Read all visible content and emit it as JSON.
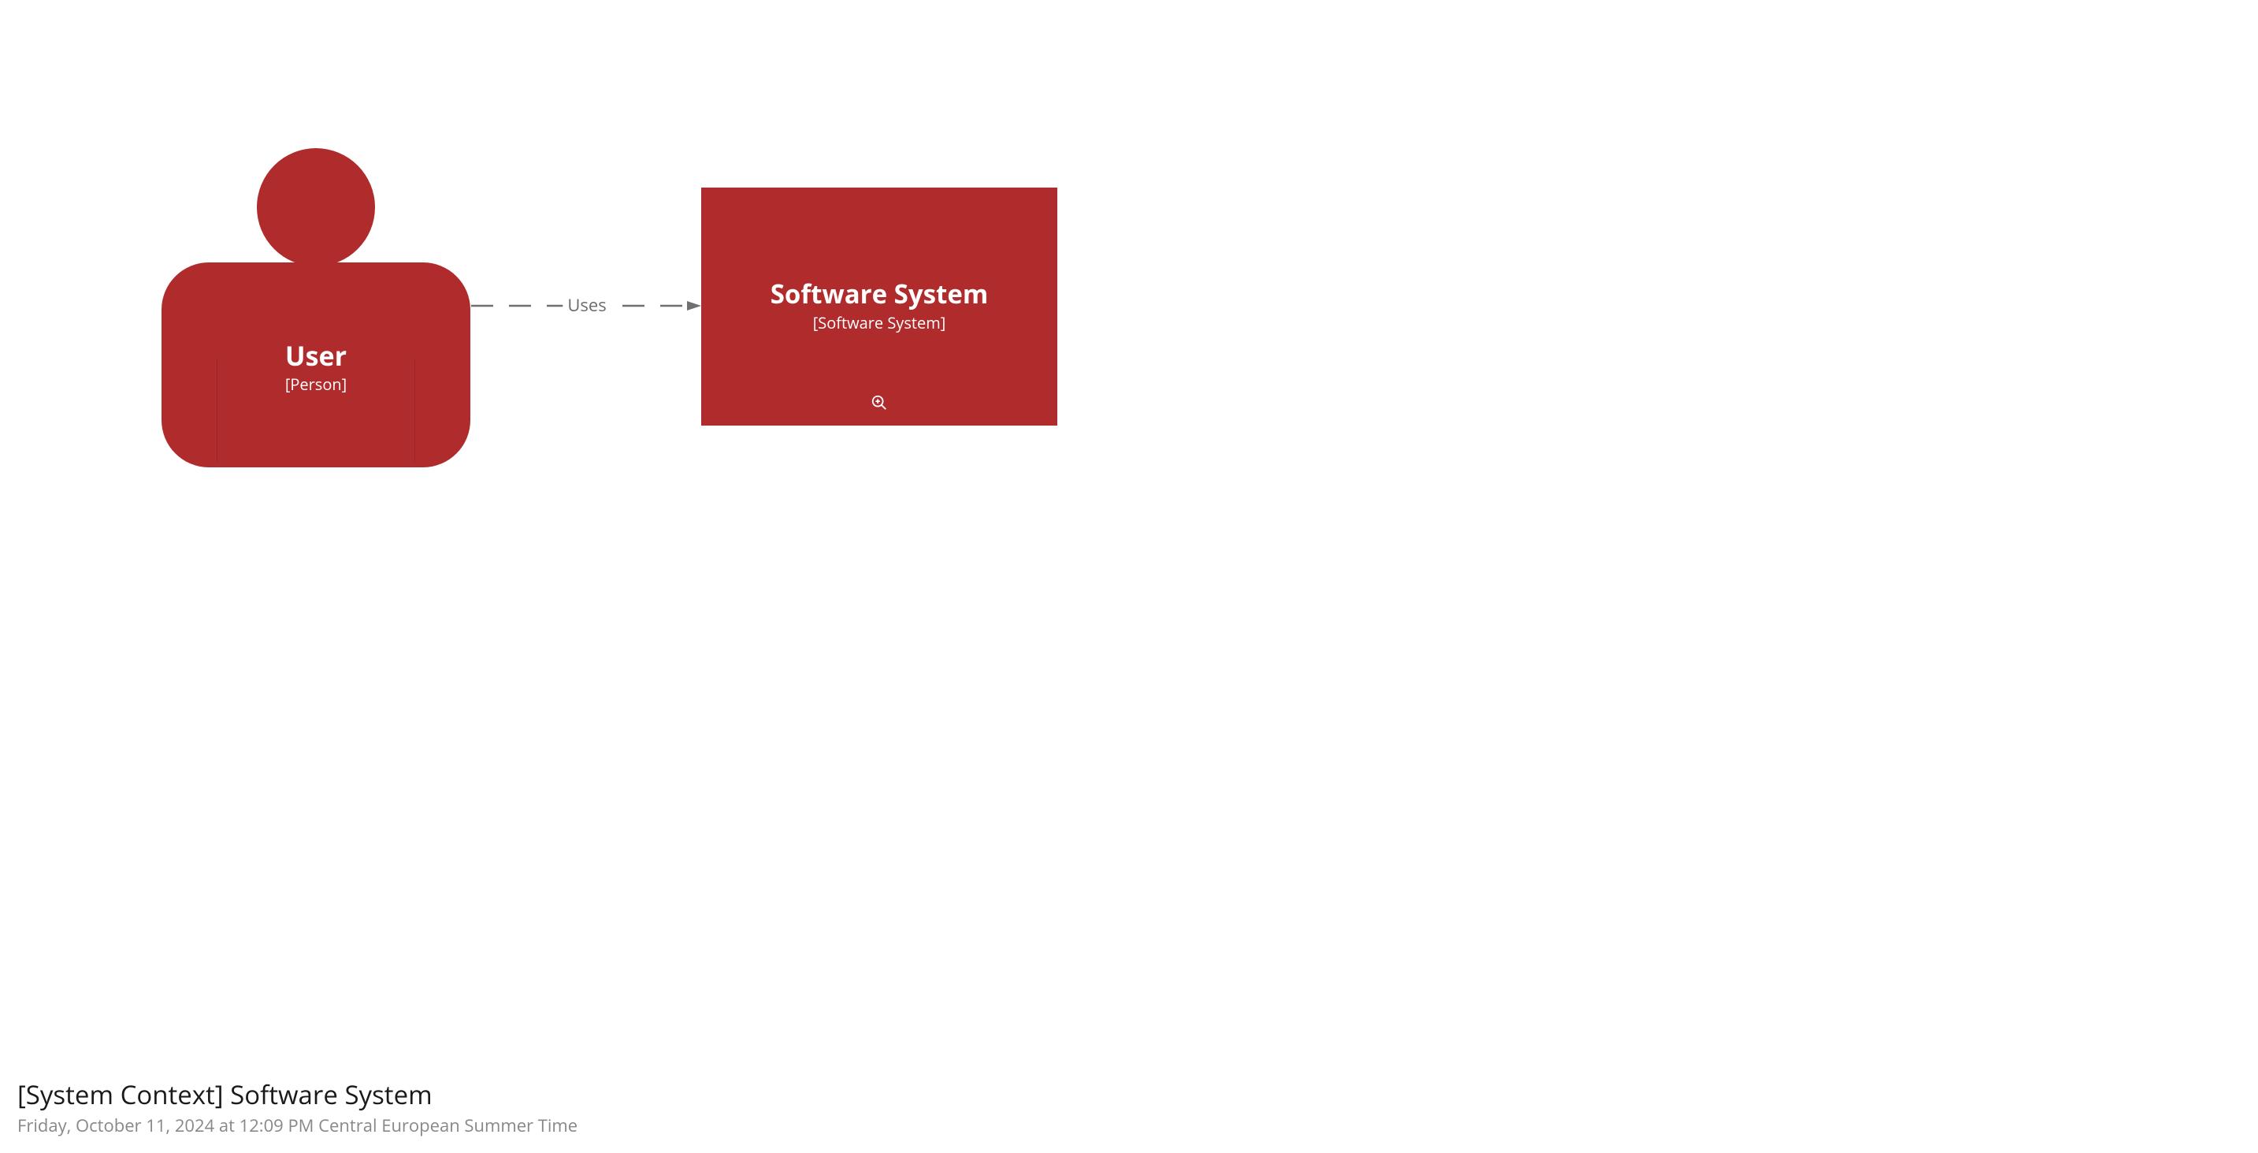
{
  "colors": {
    "shape_fill": "#B02B2B",
    "arrow": "#707070"
  },
  "person": {
    "title": "User",
    "subtitle": "[Person]"
  },
  "system": {
    "title": "Software System",
    "subtitle": "[Software System]"
  },
  "connector": {
    "label": "Uses"
  },
  "footer": {
    "title": "[System Context] Software System",
    "timestamp": "Friday, October 11, 2024 at 12:09 PM Central European Summer Time"
  }
}
